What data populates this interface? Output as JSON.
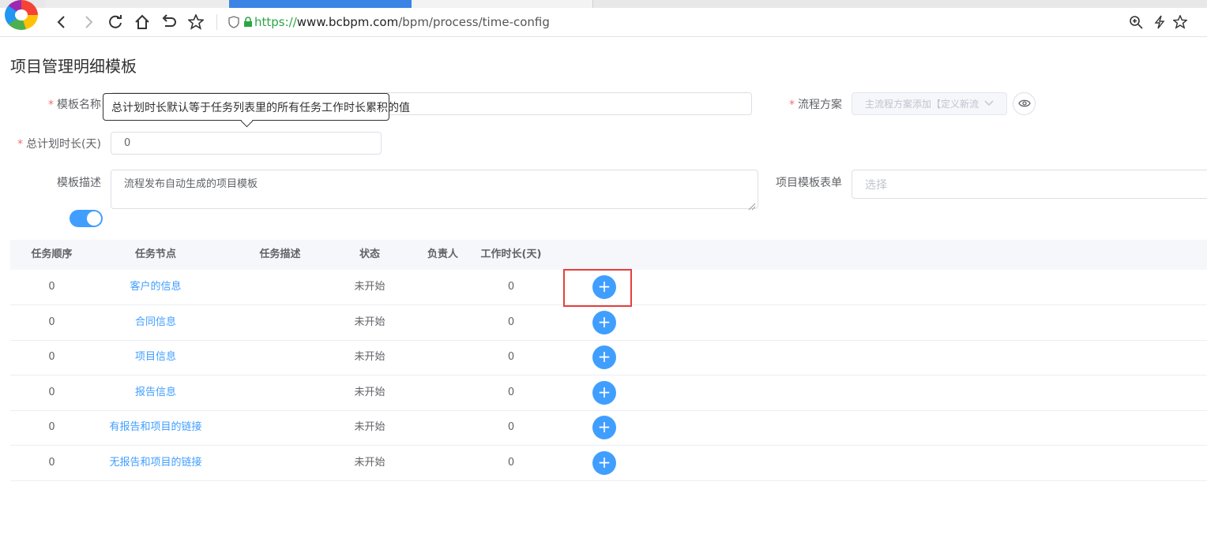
{
  "browser": {
    "url_scheme": "https://",
    "url_host": "www.bcbpm.com",
    "url_path": "/bpm/process/time-config",
    "icons": [
      "back-icon",
      "forward-icon",
      "reload-icon",
      "home-icon",
      "undo-icon",
      "star-icon",
      "shield-icon",
      "lock-icon",
      "zoom-icon",
      "lightning-icon",
      "bookmark-star-icon"
    ]
  },
  "page": {
    "title": "项目管理明细模板",
    "tooltip": "总计划时长默认等于任务列表里的所有任务工作时长累积的值"
  },
  "form": {
    "template_name_label": "模板名称",
    "process_plan_label": "流程方案",
    "process_plan_value": "主流程方案添加【定义新流",
    "total_duration_label": "总计划时长(天)",
    "total_duration_value": "0",
    "description_label": "模板描述",
    "description_value": "流程发布自动生成的项目模板",
    "template_form_label": "项目模板表单",
    "template_form_placeholder": "选择",
    "switch_on": true
  },
  "table": {
    "columns": [
      "任务顺序",
      "任务节点",
      "任务描述",
      "状态",
      "负责人",
      "工作时长(天)"
    ],
    "rows": [
      {
        "order": "0",
        "node": "客户的信息",
        "desc": "",
        "status": "未开始",
        "owner": "",
        "hours": "0"
      },
      {
        "order": "0",
        "node": "合同信息",
        "desc": "",
        "status": "未开始",
        "owner": "",
        "hours": "0"
      },
      {
        "order": "0",
        "node": "项目信息",
        "desc": "",
        "status": "未开始",
        "owner": "",
        "hours": "0"
      },
      {
        "order": "0",
        "node": "报告信息",
        "desc": "",
        "status": "未开始",
        "owner": "",
        "hours": "0"
      },
      {
        "order": "0",
        "node": "有报告和项目的链接",
        "desc": "",
        "status": "未开始",
        "owner": "",
        "hours": "0"
      },
      {
        "order": "0",
        "node": "无报告和项目的链接",
        "desc": "",
        "status": "未开始",
        "owner": "",
        "hours": "0"
      }
    ],
    "add_symbol": "+"
  },
  "colors": {
    "accent": "#409eff",
    "highlight": "#e5403a",
    "required": "#f56c6c"
  }
}
